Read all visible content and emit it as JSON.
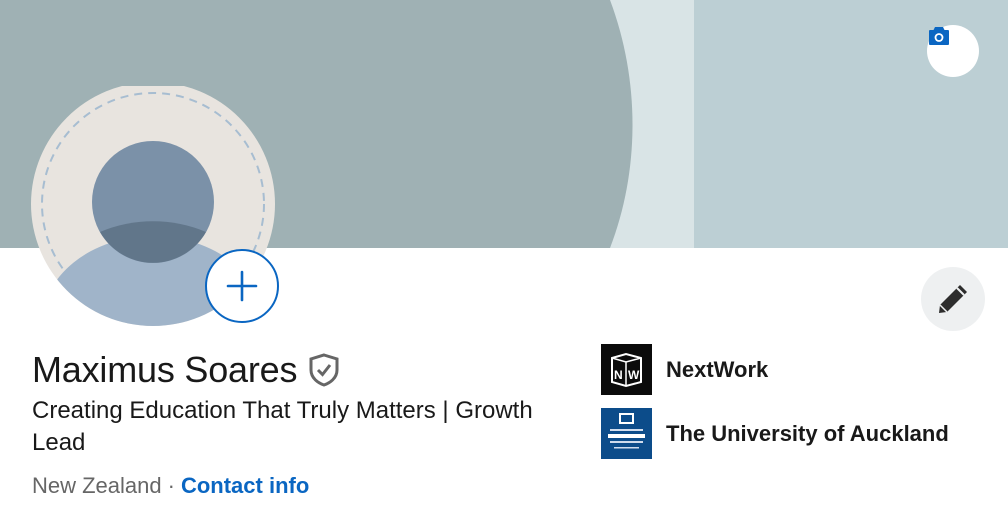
{
  "profile": {
    "name": "Maximus Soares",
    "headline": "Creating Education That Truly Matters | Growth Lead",
    "location": "New Zealand",
    "separator": "·",
    "contact_label": "Contact info"
  },
  "organizations": [
    {
      "name": "NextWork",
      "logo_text": "NW"
    },
    {
      "name": "The University of Auckland",
      "logo_text": "UNIVERSITY OF AUCKLAND"
    }
  ],
  "icons": {
    "camera": "camera-icon",
    "add": "plus-icon",
    "edit": "pencil-icon",
    "verified": "shield-check-icon"
  },
  "colors": {
    "accent": "#0a66c2",
    "banner_dark": "#9fb1b4",
    "banner_light": "#bccfd4",
    "university": "#0c4c8a"
  }
}
